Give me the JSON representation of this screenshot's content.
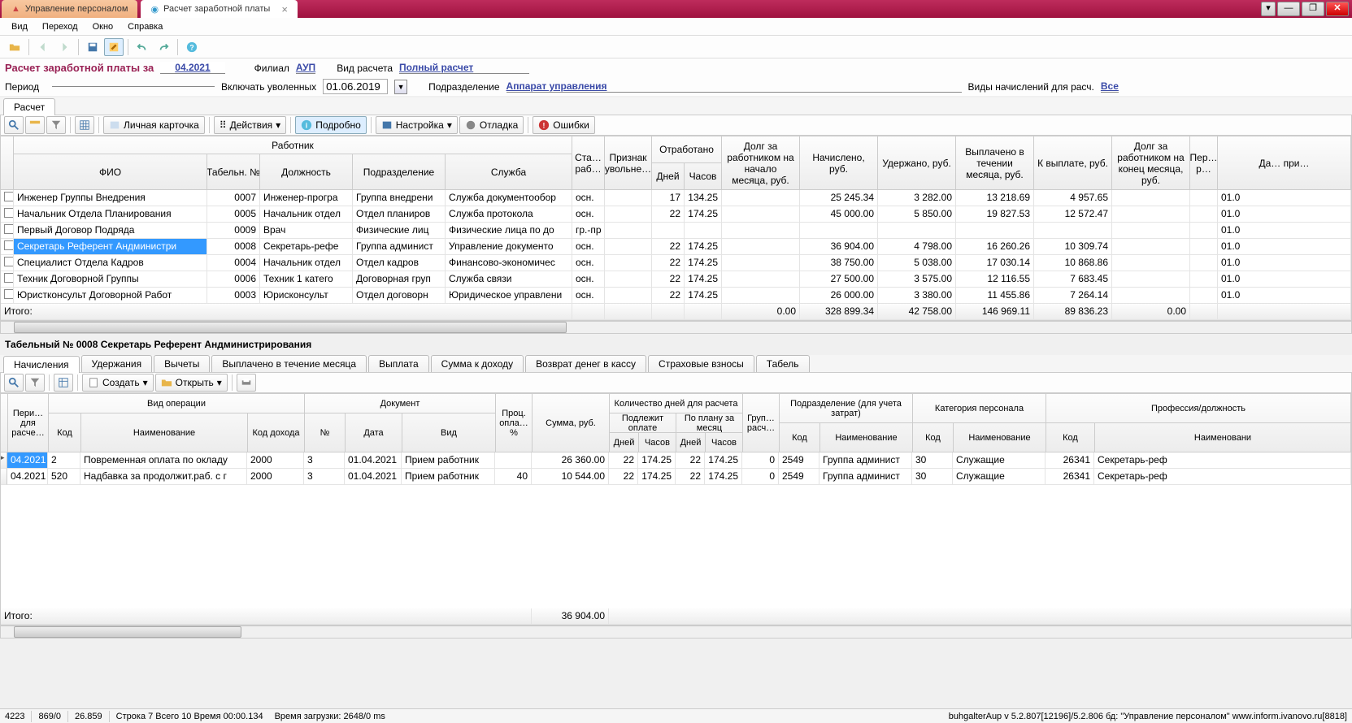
{
  "titlebar": {
    "app_tab": "Управление персоналом",
    "doc_tab": "Расчет заработной платы"
  },
  "menu": {
    "items": [
      "Вид",
      "Переход",
      "Окно",
      "Справка"
    ]
  },
  "form": {
    "title_prefix": "Расчет заработной платы за",
    "period": "04.2021",
    "filial_label": "Филиал",
    "filial_value": "АУП",
    "vidras_label": "Вид расчета",
    "vidras_value": "Полный расчет",
    "period_label": "Период",
    "include_fired_label": "Включать уволенных",
    "include_fired_date": "01.06.2019",
    "podrazd_label": "Подразделение",
    "podrazd_value": "Аппарат управления",
    "vidnach_label": "Виды начислений для расч.",
    "vidnach_value": "Все"
  },
  "main_tabs": [
    "Расчет"
  ],
  "grid_toolbar": {
    "card": "Личная карточка",
    "actions": "Действия",
    "detail": "Подробно",
    "settings": "Настройка",
    "debug": "Отладка",
    "errors": "Ошибки"
  },
  "grid": {
    "group_worker": "Работник",
    "col_fio": "ФИО",
    "col_tabno": "Табельн. №",
    "col_post": "Должность",
    "col_dept": "Подразделение",
    "col_service": "Служба",
    "col_sta": "Ста… раб…",
    "col_priznak": "Признак увольне…",
    "group_worked": "Отработано",
    "col_days": "Дней",
    "col_hours": "Часов",
    "col_debt_start": "Долг за работником на начало месяца, руб.",
    "col_accrued": "Начислено, руб.",
    "col_withheld": "Удержано, руб.",
    "col_paid_month": "Выплачено в течении месяца, руб.",
    "col_topay": "К выплате, руб.",
    "col_debt_end": "Долг за работником на конец месяца, руб.",
    "col_per": "Пер… р…",
    "col_da": "Да… при…",
    "rows": [
      {
        "fio": "Инженер Группы Внедрения",
        "tab": "0007",
        "post": "Инженер-програ",
        "dept": "Группа внедрени",
        "svc": "Служба документообор",
        "sta": "осн.",
        "days": "17",
        "hours": "134.25",
        "accr": "25 245.34",
        "with": "3 282.00",
        "paid": "13 218.69",
        "topay": "4 957.65",
        "per": "",
        "da": "01.0"
      },
      {
        "fio": "Начальник Отдела Планирования",
        "tab": "0005",
        "post": "Начальник отдел",
        "dept": "Отдел планиров",
        "svc": "Служба протокола",
        "sta": "осн.",
        "days": "22",
        "hours": "174.25",
        "accr": "45 000.00",
        "with": "5 850.00",
        "paid": "19 827.53",
        "topay": "12 572.47",
        "per": "",
        "da": "01.0"
      },
      {
        "fio": "Первый Договор Подряда",
        "tab": "0009",
        "post": "Врач",
        "dept": "Физические лиц",
        "svc": "Физические лица по до",
        "sta": "гр.-пр",
        "days": "",
        "hours": "",
        "accr": "",
        "with": "",
        "paid": "",
        "topay": "",
        "per": "",
        "da": "01.0"
      },
      {
        "fio": "Секретарь Референт Андминистри",
        "tab": "0008",
        "post": "Секретарь-рефе",
        "dept": "Группа админист",
        "svc": "Управление документо",
        "sta": "осн.",
        "days": "22",
        "hours": "174.25",
        "accr": "36 904.00",
        "with": "4 798.00",
        "paid": "16 260.26",
        "topay": "10 309.74",
        "per": "",
        "da": "01.0",
        "sel": true
      },
      {
        "fio": "Специалист Отдела Кадров",
        "tab": "0004",
        "post": "Начальник отдел",
        "dept": "Отдел кадров",
        "svc": "Финансово-экономичес",
        "sta": "осн.",
        "days": "22",
        "hours": "174.25",
        "accr": "38 750.00",
        "with": "5 038.00",
        "paid": "17 030.14",
        "topay": "10 868.86",
        "per": "",
        "da": "01.0"
      },
      {
        "fio": "Техник Договорной Группы",
        "tab": "0006",
        "post": "Техник 1 катего",
        "dept": "Договорная груп",
        "svc": "Служба связи",
        "sta": "осн.",
        "days": "22",
        "hours": "174.25",
        "accr": "27 500.00",
        "with": "3 575.00",
        "paid": "12 116.55",
        "topay": "7 683.45",
        "per": "",
        "da": "01.0"
      },
      {
        "fio": "Юристконсульт Договорной Работ",
        "tab": "0003",
        "post": "Юрисконсульт",
        "dept": "Отдел договорн",
        "svc": "Юридическое управлени",
        "sta": "осн.",
        "days": "22",
        "hours": "174.25",
        "accr": "26 000.00",
        "with": "3 380.00",
        "paid": "11 455.86",
        "topay": "7 264.14",
        "per": "",
        "da": "01.0"
      }
    ],
    "footer": {
      "label": "Итого:",
      "debt_start": "0.00",
      "accr": "328 899.34",
      "with": "42 758.00",
      "paid": "146 969.11",
      "topay": "89 836.23",
      "debt_end": "0.00"
    }
  },
  "detail": {
    "title": "Табельный № 0008 Секретарь Референт Андминистрирования",
    "tabs": [
      "Начисления",
      "Удержания",
      "Вычеты",
      "Выплачено в течение месяца",
      "Выплата",
      "Сумма к доходу",
      "Возврат денег в кассу",
      "Страховые взносы",
      "Табель"
    ],
    "toolbar": {
      "create": "Создать",
      "open": "Открыть"
    },
    "headers": {
      "period": "Пери… для расче…",
      "oper": "Вид операции",
      "code": "Код",
      "name": "Наименование",
      "incode": "Код дохода",
      "doc": "Документ",
      "docno": "№",
      "docdate": "Дата",
      "docvid": "Вид",
      "pct": "Проц. опла… %",
      "sum": "Сумма, руб.",
      "calcdays": "Количество дней для расчета",
      "payable": "Подлежит оплате",
      "plan": "По плану за месяц",
      "days2": "Дней",
      "hours2": "Часов",
      "grp": "Груп… расч…",
      "dept": "Подразделение (для учета затрат)",
      "deptcode": "Код",
      "deptname": "Наименование",
      "cat": "Категория персонала",
      "catcode": "Код",
      "catname": "Наименование",
      "prof": "Профессия/должность",
      "profcode": "Код",
      "profname": "Наименовани"
    },
    "rows": [
      {
        "per": "04.2021",
        "code": "2",
        "name": "Повременная оплата по окладу",
        "incode": "2000",
        "docno": "3",
        "docdate": "01.04.2021",
        "docvid": "Прием работник",
        "pct": "",
        "sum": "26 360.00",
        "pd": "22",
        "ph": "174.25",
        "pld": "22",
        "plh": "174.25",
        "grp": "0",
        "dcode": "2549",
        "dname": "Группа админист",
        "ccode": "30",
        "cname": "Служащие",
        "pcode": "26341",
        "pname": "Секретарь-реф",
        "sel": true
      },
      {
        "per": "04.2021",
        "code": "520",
        "name": "Надбавка за продолжит.раб. с г",
        "incode": "2000",
        "docno": "3",
        "docdate": "01.04.2021",
        "docvid": "Прием работник",
        "pct": "40",
        "sum": "10 544.00",
        "pd": "22",
        "ph": "174.25",
        "pld": "22",
        "plh": "174.25",
        "grp": "0",
        "dcode": "2549",
        "dname": "Группа админист",
        "ccode": "30",
        "cname": "Служащие",
        "pcode": "26341",
        "pname": "Секретарь-реф"
      }
    ],
    "footer": {
      "label": "Итого:",
      "sum": "36 904.00"
    }
  },
  "status": {
    "f1": "4223",
    "f2": "869/0",
    "f3": "26.859",
    "f4": "Строка 7 Всего 10 Время 00:00.134",
    "f5": "Время загрузки: 2648/0 ms",
    "right": "buhgalterAup  v 5.2.807[12196]/5.2.806  бд: \"Управление персоналом\" www.inform.ivanovo.ru[8818]"
  }
}
